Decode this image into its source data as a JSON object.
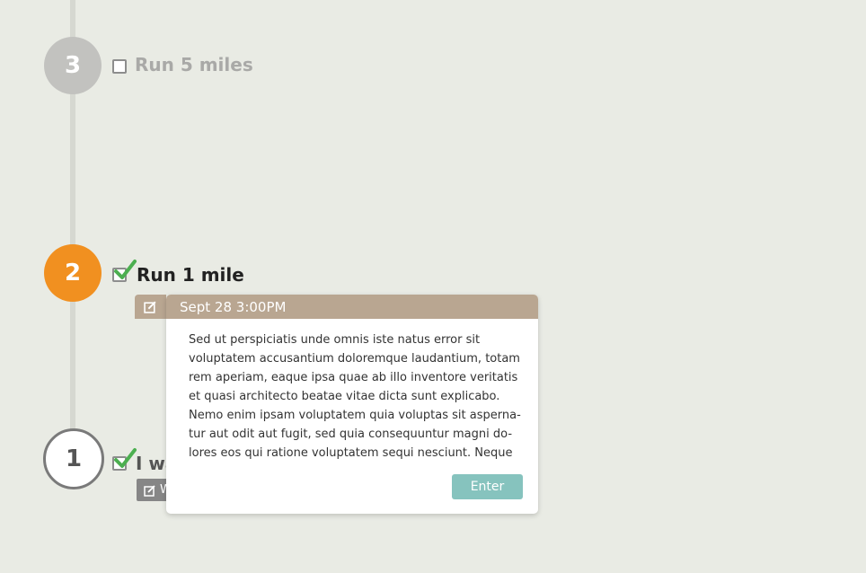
{
  "timeline": {
    "steps": [
      {
        "number": "3",
        "task": "Run 5 miles",
        "checked": false
      },
      {
        "number": "2",
        "task": "Run 1 mile",
        "checked": true
      },
      {
        "number": "1",
        "task": "I wa",
        "checked": true,
        "note_tab_text": "W"
      }
    ]
  },
  "popup": {
    "header": "Sept 28 3:00PM",
    "body": "Sed ut perspiciatis unde omnis iste natus error sit voluptatem accusantium doloremque laudantium, totam rem aperiam, eaque ipsa quae ab illo inventore veritatis et quasi architecto beatae vitae dicta sunt explicabo. Nemo enim ipsam voluptatem quia voluptas sit asperna-tur aut odit aut fugit, sed quia consequuntur magni do-lores eos qui ratione voluptatem sequi nesciunt. Neque",
    "enter_label": "Enter"
  },
  "colors": {
    "active_step": "#f19020",
    "inactive_step": "#c2c2bf",
    "note_header": "#b9a691",
    "enter_button": "#86c3be",
    "check": "#4caf50"
  },
  "icons": {
    "edit": "edit-icon",
    "check": "checkmark-icon"
  }
}
